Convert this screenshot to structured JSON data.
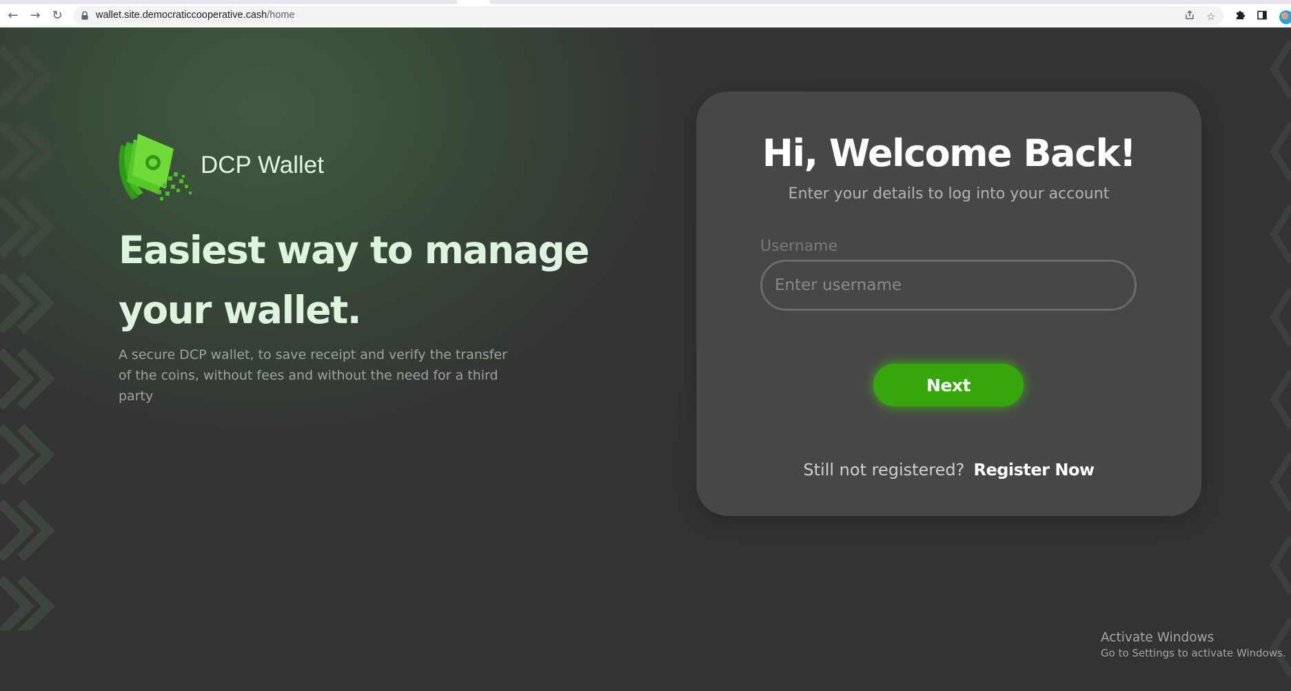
{
  "browser": {
    "url_host": "wallet.site.democraticcooperative.cash",
    "url_path": "/home",
    "icons": [
      "back-arrow",
      "forward-arrow",
      "reload",
      "lock",
      "share",
      "bookmark-star",
      "extensions-puzzle",
      "side-panel",
      "profile-avatar"
    ]
  },
  "hero": {
    "brand_name": "DCP Wallet",
    "headline_line1": "Easiest way to manage",
    "headline_line2": "your wallet.",
    "subtext": "A secure DCP wallet, to save receipt and verify the transfer of the coins, without fees and without the need for a third party"
  },
  "login": {
    "title": "Hi, Welcome Back!",
    "subtitle": "Enter your details to log into your account",
    "username_label": "Username",
    "username_placeholder": "Enter username",
    "username_value": "",
    "next_label": "Next",
    "register_prompt": "Still not registered?",
    "register_link": "Register Now"
  },
  "watermark": {
    "line1": "Activate Windows",
    "line2": "Go to Settings to activate Windows."
  },
  "colors": {
    "accent_green": "#36a60c",
    "card_bg": "#474747",
    "page_bg": "#333333",
    "headline": "#dff4df"
  }
}
